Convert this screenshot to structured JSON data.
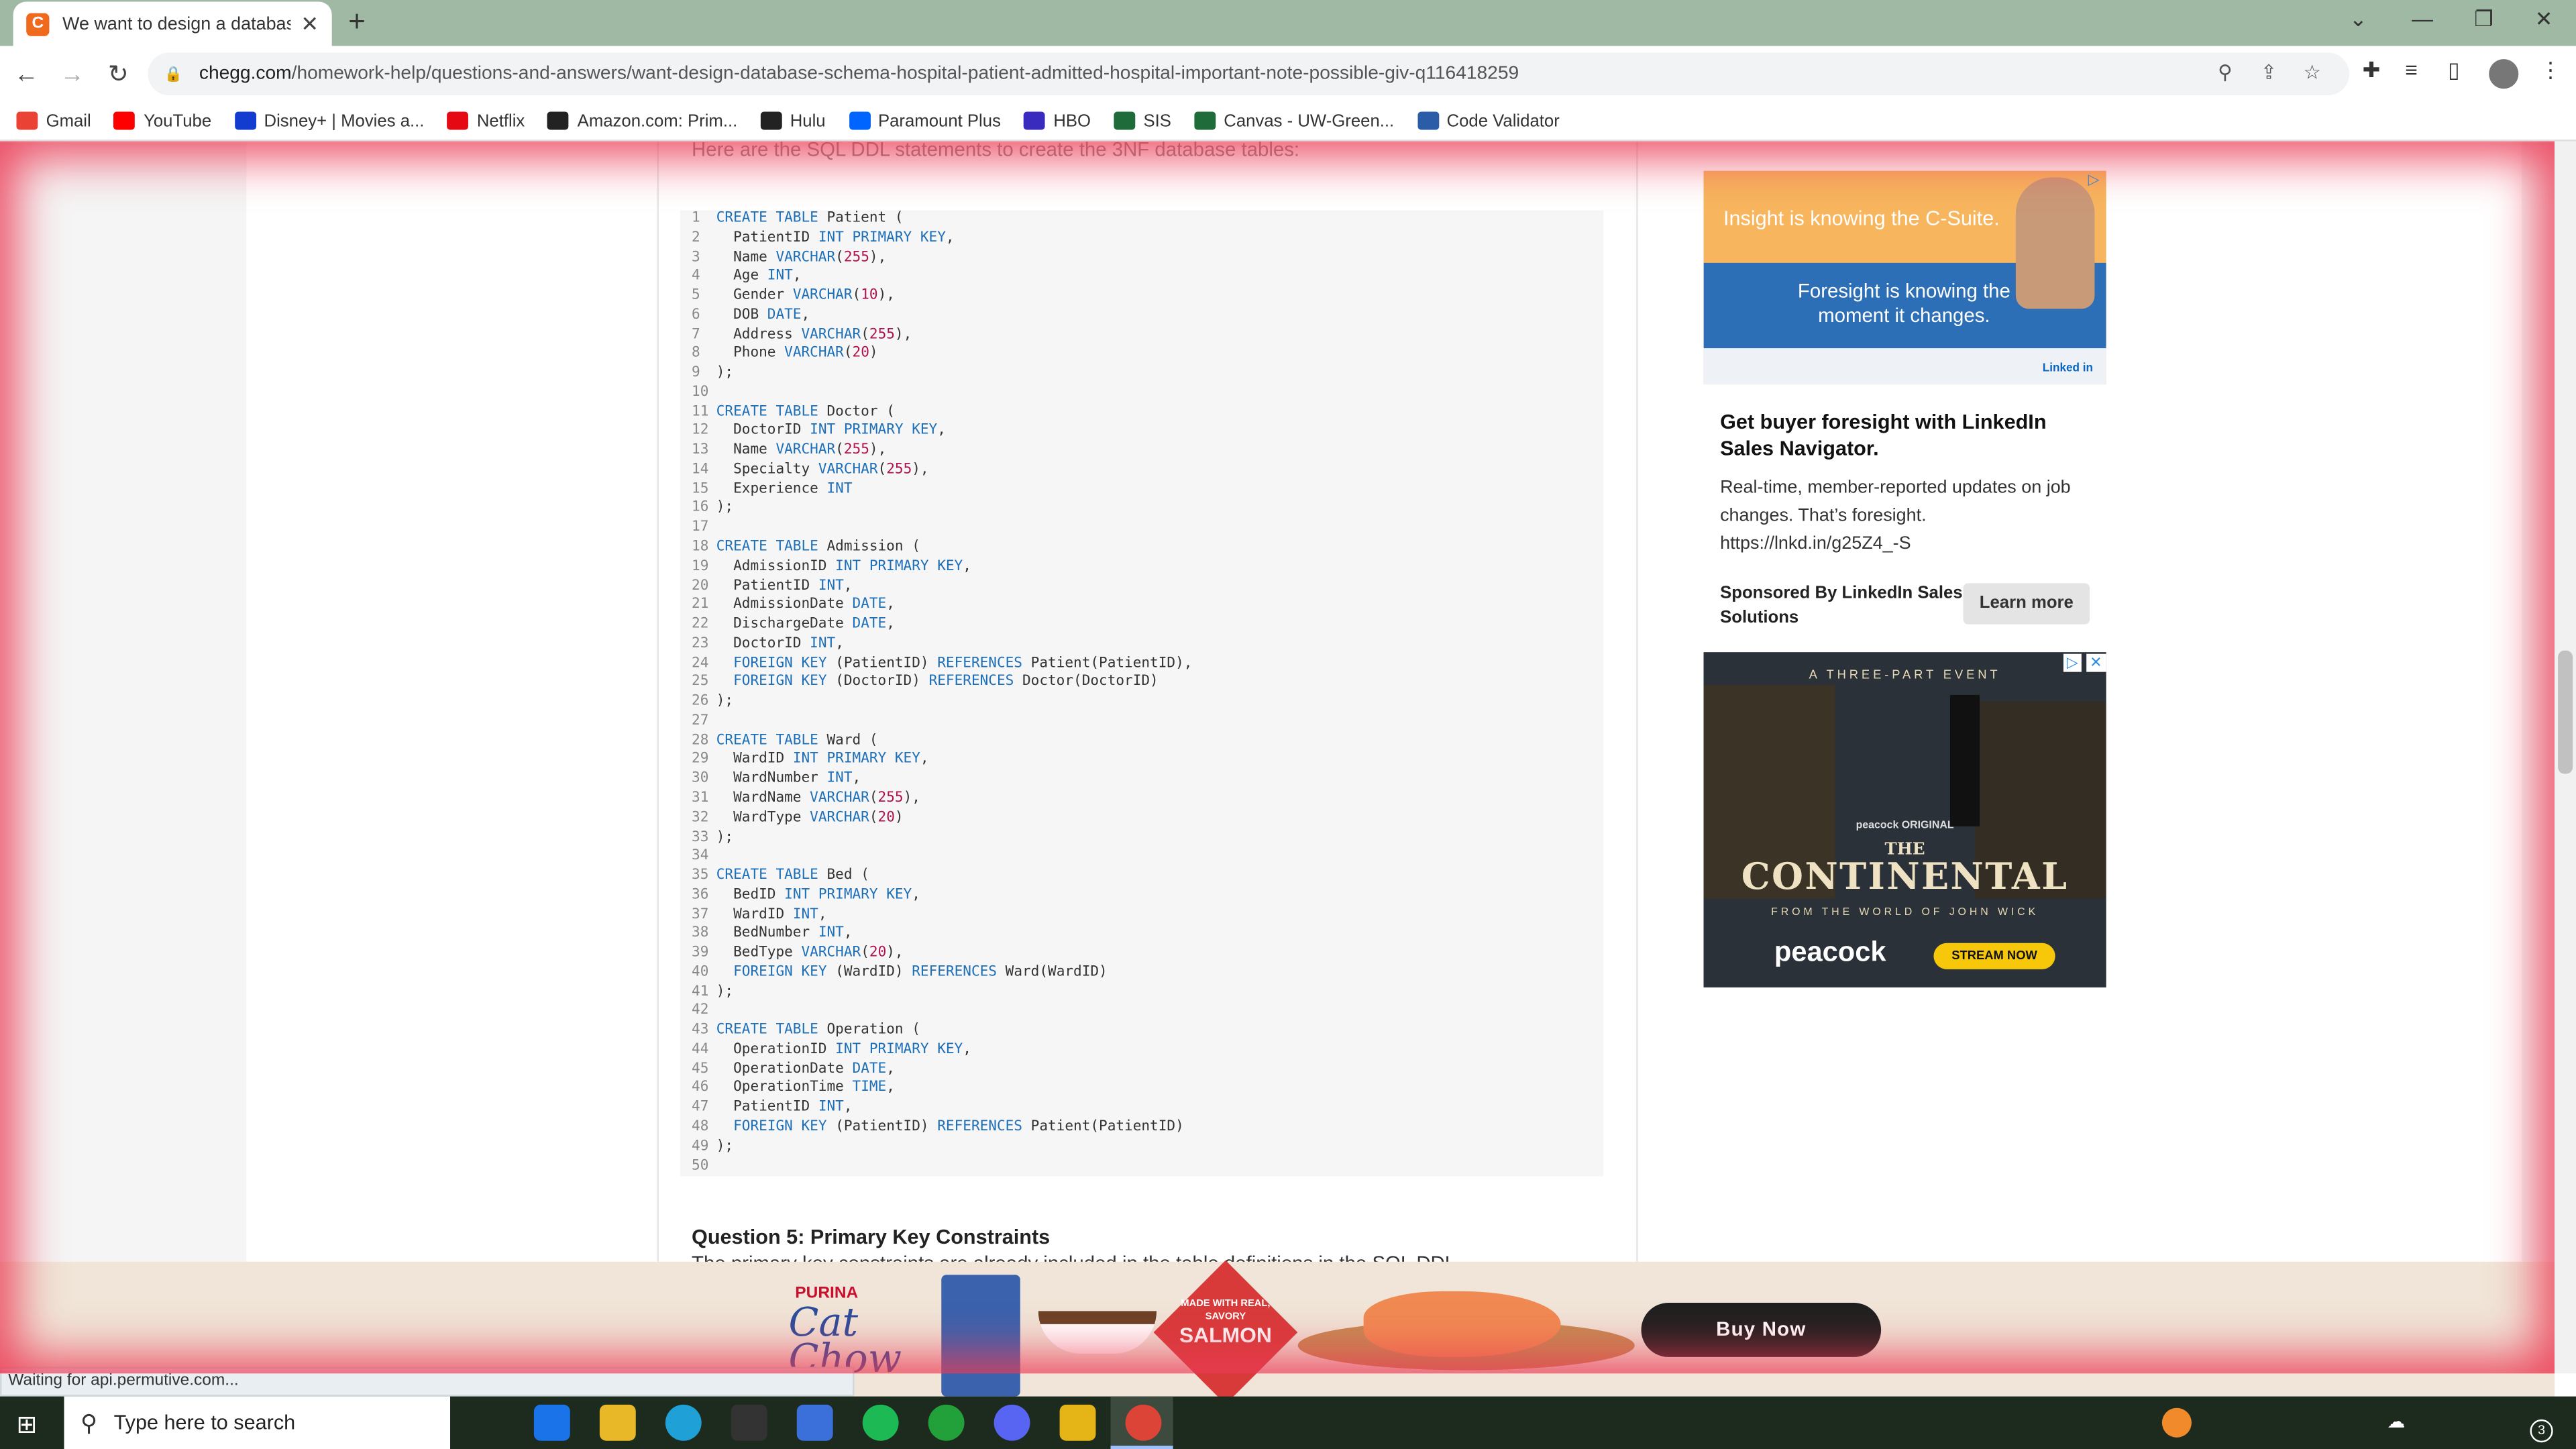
{
  "browser": {
    "tab_title": "We want to design a database sc",
    "tab_favicon": "C",
    "url_host": "chegg.com",
    "url_path": "/homework-help/questions-and-answers/want-design-database-schema-hospital-patient-admitted-hospital-important-note-possible-giv-q116418259",
    "status_text": "Waiting for api.permutive.com..."
  },
  "bookmarks": [
    {
      "label": "Gmail",
      "icon": "gmail-icon",
      "color": "#ea4335"
    },
    {
      "label": "YouTube",
      "icon": "youtube-icon",
      "color": "#ff0000"
    },
    {
      "label": "Disney+ | Movies a...",
      "icon": "disney-icon",
      "color": "#113ccf"
    },
    {
      "label": "Netflix",
      "icon": "netflix-icon",
      "color": "#e50914"
    },
    {
      "label": "Amazon.com: Prim...",
      "icon": "amazon-icon",
      "color": "#222222"
    },
    {
      "label": "Hulu",
      "icon": "hulu-icon",
      "color": "#222222"
    },
    {
      "label": "Paramount Plus",
      "icon": "paramount-icon",
      "color": "#0064ff"
    },
    {
      "label": "HBO",
      "icon": "hbo-icon",
      "color": "#3a2bbf"
    },
    {
      "label": "SIS",
      "icon": "sis-icon",
      "color": "#1f6b3a"
    },
    {
      "label": "Canvas - UW-Green...",
      "icon": "canvas-icon",
      "color": "#1f6b3a"
    },
    {
      "label": "Code Validator",
      "icon": "w3-icon",
      "color": "#2a5ca8"
    }
  ],
  "article": {
    "intro": "Here are the SQL DDL statements to create the 3NF database tables:",
    "code_lines": [
      [
        [
          "kw",
          "CREATE TABLE"
        ],
        [
          "t",
          " Patient "
        ],
        [
          "p",
          "("
        ]
      ],
      [
        [
          "t",
          "  PatientID "
        ],
        [
          "kw",
          "INT PRIMARY KEY"
        ],
        [
          "p",
          ","
        ]
      ],
      [
        [
          "t",
          "  Name "
        ],
        [
          "kw",
          "VARCHAR"
        ],
        [
          "p",
          "("
        ],
        [
          "n",
          "255"
        ],
        [
          "p",
          "),"
        ]
      ],
      [
        [
          "t",
          "  Age "
        ],
        [
          "kw",
          "INT"
        ],
        [
          "p",
          ","
        ]
      ],
      [
        [
          "t",
          "  Gender "
        ],
        [
          "kw",
          "VARCHAR"
        ],
        [
          "p",
          "("
        ],
        [
          "n",
          "10"
        ],
        [
          "p",
          "),"
        ]
      ],
      [
        [
          "t",
          "  DOB "
        ],
        [
          "kw",
          "DATE"
        ],
        [
          "p",
          ","
        ]
      ],
      [
        [
          "t",
          "  Address "
        ],
        [
          "kw",
          "VARCHAR"
        ],
        [
          "p",
          "("
        ],
        [
          "n",
          "255"
        ],
        [
          "p",
          "),"
        ]
      ],
      [
        [
          "t",
          "  Phone "
        ],
        [
          "kw",
          "VARCHAR"
        ],
        [
          "p",
          "("
        ],
        [
          "n",
          "20"
        ],
        [
          "p",
          ")"
        ]
      ],
      [
        [
          "p",
          ");"
        ]
      ],
      [],
      [
        [
          "kw",
          "CREATE TABLE"
        ],
        [
          "t",
          " Doctor "
        ],
        [
          "p",
          "("
        ]
      ],
      [
        [
          "t",
          "  DoctorID "
        ],
        [
          "kw",
          "INT PRIMARY KEY"
        ],
        [
          "p",
          ","
        ]
      ],
      [
        [
          "t",
          "  Name "
        ],
        [
          "kw",
          "VARCHAR"
        ],
        [
          "p",
          "("
        ],
        [
          "n",
          "255"
        ],
        [
          "p",
          "),"
        ]
      ],
      [
        [
          "t",
          "  Specialty "
        ],
        [
          "kw",
          "VARCHAR"
        ],
        [
          "p",
          "("
        ],
        [
          "n",
          "255"
        ],
        [
          "p",
          "),"
        ]
      ],
      [
        [
          "t",
          "  Experience "
        ],
        [
          "kw",
          "INT"
        ]
      ],
      [
        [
          "p",
          ");"
        ]
      ],
      [],
      [
        [
          "kw",
          "CREATE TABLE"
        ],
        [
          "t",
          " Admission "
        ],
        [
          "p",
          "("
        ]
      ],
      [
        [
          "t",
          "  AdmissionID "
        ],
        [
          "kw",
          "INT PRIMARY KEY"
        ],
        [
          "p",
          ","
        ]
      ],
      [
        [
          "t",
          "  PatientID "
        ],
        [
          "kw",
          "INT"
        ],
        [
          "p",
          ","
        ]
      ],
      [
        [
          "t",
          "  AdmissionDate "
        ],
        [
          "kw",
          "DATE"
        ],
        [
          "p",
          ","
        ]
      ],
      [
        [
          "t",
          "  DischargeDate "
        ],
        [
          "kw",
          "DATE"
        ],
        [
          "p",
          ","
        ]
      ],
      [
        [
          "t",
          "  DoctorID "
        ],
        [
          "kw",
          "INT"
        ],
        [
          "p",
          ","
        ]
      ],
      [
        [
          "t",
          "  "
        ],
        [
          "kw",
          "FOREIGN KEY"
        ],
        [
          "t",
          " (PatientID) "
        ],
        [
          "kw",
          "REFERENCES"
        ],
        [
          "t",
          " Patient(PatientID),"
        ]
      ],
      [
        [
          "t",
          "  "
        ],
        [
          "kw",
          "FOREIGN KEY"
        ],
        [
          "t",
          " (DoctorID) "
        ],
        [
          "kw",
          "REFERENCES"
        ],
        [
          "t",
          " Doctor(DoctorID)"
        ]
      ],
      [
        [
          "p",
          ");"
        ]
      ],
      [],
      [
        [
          "kw",
          "CREATE TABLE"
        ],
        [
          "t",
          " Ward "
        ],
        [
          "p",
          "("
        ]
      ],
      [
        [
          "t",
          "  WardID "
        ],
        [
          "kw",
          "INT PRIMARY KEY"
        ],
        [
          "p",
          ","
        ]
      ],
      [
        [
          "t",
          "  WardNumber "
        ],
        [
          "kw",
          "INT"
        ],
        [
          "p",
          ","
        ]
      ],
      [
        [
          "t",
          "  WardName "
        ],
        [
          "kw",
          "VARCHAR"
        ],
        [
          "p",
          "("
        ],
        [
          "n",
          "255"
        ],
        [
          "p",
          "),"
        ]
      ],
      [
        [
          "t",
          "  WardType "
        ],
        [
          "kw",
          "VARCHAR"
        ],
        [
          "p",
          "("
        ],
        [
          "n",
          "20"
        ],
        [
          "p",
          ")"
        ]
      ],
      [
        [
          "p",
          ");"
        ]
      ],
      [],
      [
        [
          "kw",
          "CREATE TABLE"
        ],
        [
          "t",
          " Bed "
        ],
        [
          "p",
          "("
        ]
      ],
      [
        [
          "t",
          "  BedID "
        ],
        [
          "kw",
          "INT PRIMARY KEY"
        ],
        [
          "p",
          ","
        ]
      ],
      [
        [
          "t",
          "  WardID "
        ],
        [
          "kw",
          "INT"
        ],
        [
          "p",
          ","
        ]
      ],
      [
        [
          "t",
          "  BedNumber "
        ],
        [
          "kw",
          "INT"
        ],
        [
          "p",
          ","
        ]
      ],
      [
        [
          "t",
          "  BedType "
        ],
        [
          "kw",
          "VARCHAR"
        ],
        [
          "p",
          "("
        ],
        [
          "n",
          "20"
        ],
        [
          "p",
          "),"
        ]
      ],
      [
        [
          "t",
          "  "
        ],
        [
          "kw",
          "FOREIGN KEY"
        ],
        [
          "t",
          " (WardID) "
        ],
        [
          "kw",
          "REFERENCES"
        ],
        [
          "t",
          " Ward(WardID)"
        ]
      ],
      [
        [
          "p",
          ");"
        ]
      ],
      [],
      [
        [
          "kw",
          "CREATE TABLE"
        ],
        [
          "t",
          " Operation "
        ],
        [
          "p",
          "("
        ]
      ],
      [
        [
          "t",
          "  OperationID "
        ],
        [
          "kw",
          "INT PRIMARY KEY"
        ],
        [
          "p",
          ","
        ]
      ],
      [
        [
          "t",
          "  OperationDate "
        ],
        [
          "kw",
          "DATE"
        ],
        [
          "p",
          ","
        ]
      ],
      [
        [
          "t",
          "  OperationTime "
        ],
        [
          "kw",
          "TIME"
        ],
        [
          "p",
          ","
        ]
      ],
      [
        [
          "t",
          "  PatientID "
        ],
        [
          "kw",
          "INT"
        ],
        [
          "p",
          ","
        ]
      ],
      [
        [
          "t",
          "  "
        ],
        [
          "kw",
          "FOREIGN KEY"
        ],
        [
          "t",
          " (PatientID) "
        ],
        [
          "kw",
          "REFERENCES"
        ],
        [
          "t",
          " Patient(PatientID)"
        ]
      ],
      [
        [
          "p",
          ");"
        ]
      ],
      []
    ],
    "question_heading": "Question 5: Primary Key Constraints",
    "question_snippet": "The primary key constraints are already included in the table definitions in the SQL DDL"
  },
  "ads": {
    "linkedin": {
      "headline_top": "Insight is knowing the C-Suite.",
      "headline_band": "Foresight is knowing the moment it changes.",
      "brand": "Linked in",
      "title": "Get buyer foresight with LinkedIn Sales Navigator.",
      "body": "Real-time, member-reported updates on job changes. That’s foresight. https://lnkd.in/g25Z4_-S",
      "sponsor": "Sponsored By LinkedIn Sales Solutions",
      "cta": "Learn more"
    },
    "continental": {
      "event": "A THREE-PART EVENT",
      "original": "peacock ORIGINAL",
      "the": "THE",
      "title": "CONTINENTAL",
      "from": "FROM THE WORLD OF JOHN WICK",
      "brand": "peacock",
      "cta": "STREAM NOW"
    },
    "banner": {
      "brand_top": "PURINA",
      "brand": "Cat Chow",
      "badge_small": "MADE WITH REAL, SAVORY",
      "badge_big": "SALMON",
      "cta": "Buy Now"
    }
  },
  "taskbar": {
    "search_placeholder": "Type here to search",
    "apps": [
      {
        "name": "mail-icon",
        "color": "#1a73e8"
      },
      {
        "name": "file-explorer-icon",
        "color": "#e8b829"
      },
      {
        "name": "edge-icon",
        "color": "#1fa0d6"
      },
      {
        "name": "epic-games-icon",
        "color": "#333333"
      },
      {
        "name": "app-icon",
        "color": "#3b6fd9"
      },
      {
        "name": "spotify-icon",
        "color": "#1db954"
      },
      {
        "name": "xbox-icon",
        "color": "#22a13a"
      },
      {
        "name": "discord-icon",
        "color": "#5865f2"
      },
      {
        "name": "roblox-icon",
        "color": "#e5b416"
      },
      {
        "name": "chrome-icon",
        "color": "#db4437"
      }
    ],
    "notification_count": "3"
  }
}
